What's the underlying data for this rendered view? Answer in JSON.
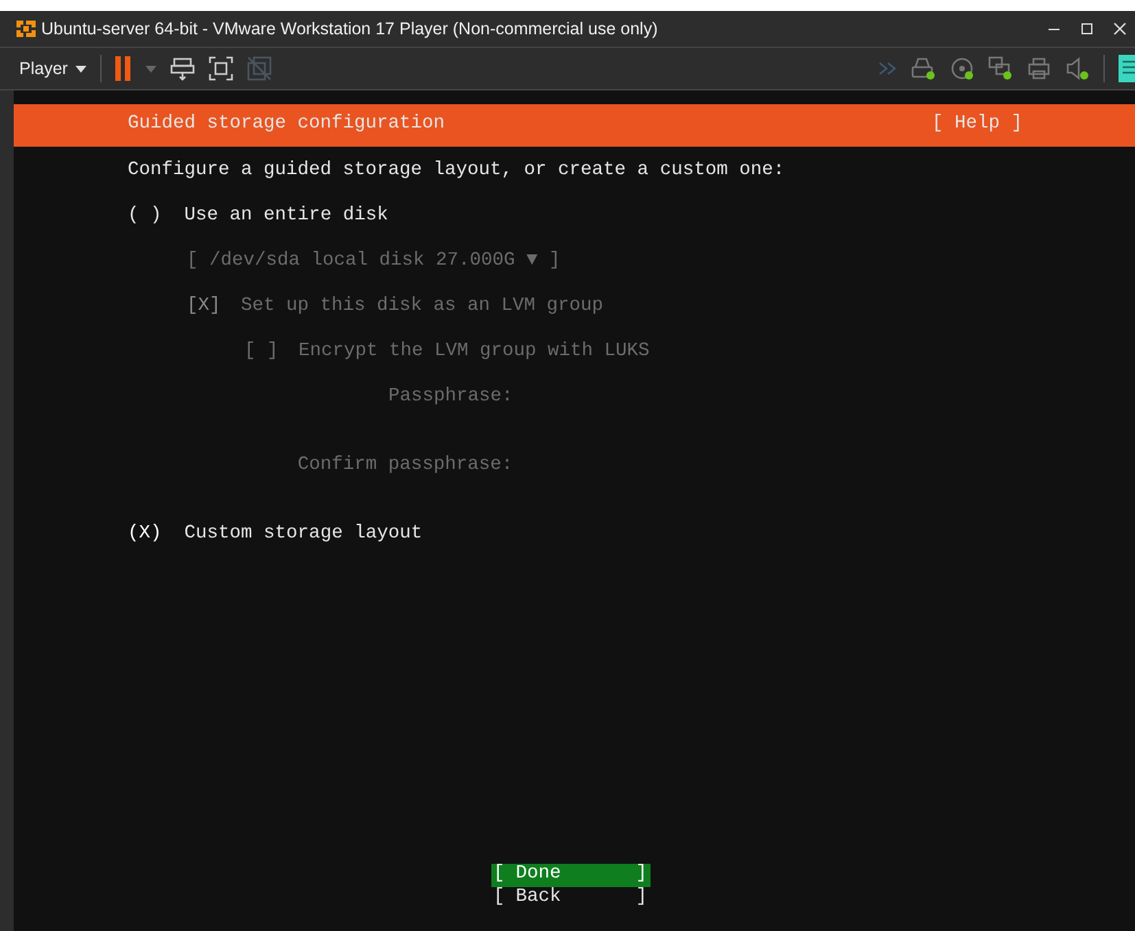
{
  "window": {
    "title": "Ubuntu-server 64-bit - VMware Workstation 17 Player (Non-commercial use only)"
  },
  "toolbar": {
    "menu": "Player"
  },
  "header": {
    "title": "Guided storage configuration",
    "help": "[ Help ]"
  },
  "prompt": "Configure a guided storage layout, or create a custom one:",
  "options": [
    {
      "mark": "( )",
      "label": "Use an entire disk",
      "selected": false,
      "disk_select": {
        "text": "[ /dev/sda local disk 27.000G ▼ ]",
        "disabled": true
      },
      "lvm": {
        "mark": "[X]",
        "label": "Set up this disk as an LVM group",
        "checked": true,
        "disabled": true,
        "encrypt": {
          "mark": "[ ]",
          "label": "Encrypt the LVM group with LUKS",
          "checked": false,
          "disabled": true
        },
        "fields": [
          {
            "label": "Passphrase:",
            "disabled": true
          },
          {
            "label": "Confirm passphrase:",
            "disabled": true
          }
        ]
      }
    },
    {
      "mark": "(X)",
      "label": "Custom storage layout",
      "selected": true
    }
  ],
  "buttons": [
    {
      "open": "[",
      "label": "Done",
      "close": "]",
      "selected": true
    },
    {
      "open": "[",
      "label": "Back",
      "close": "]",
      "selected": false
    }
  ]
}
